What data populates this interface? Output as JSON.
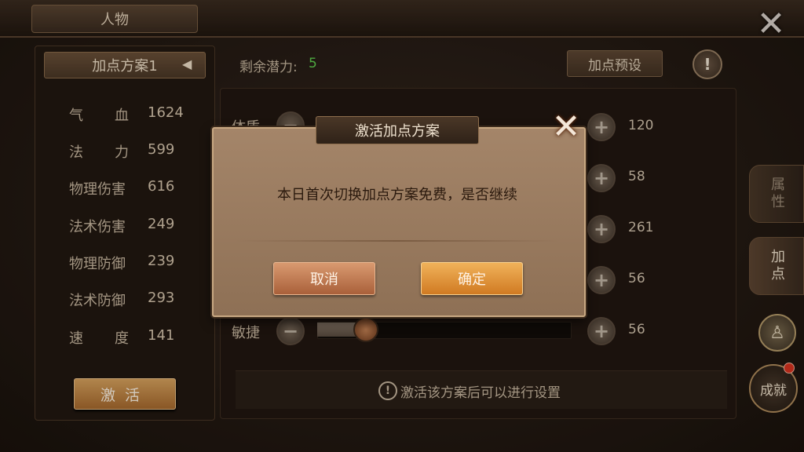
{
  "window": {
    "title": "人物"
  },
  "left_panel": {
    "scheme_label": "加点方案1",
    "stats": [
      {
        "label_chars": [
          "气",
          "血"
        ],
        "value": "1624"
      },
      {
        "label_chars": [
          "法",
          "力"
        ],
        "value": "599"
      },
      {
        "label": "物理伤害",
        "value": "616"
      },
      {
        "label": "法术伤害",
        "value": "249"
      },
      {
        "label": "物理防御",
        "value": "239"
      },
      {
        "label": "法术防御",
        "value": "293"
      },
      {
        "label_chars": [
          "速",
          "度"
        ],
        "value": "141"
      }
    ],
    "activate_label": "激活"
  },
  "main": {
    "remaining_label": "剩余潜力:",
    "remaining_value": "5",
    "preset_label": "加点预设",
    "attributes": [
      {
        "label": "体质",
        "value": "120"
      },
      {
        "label": "",
        "value": "58"
      },
      {
        "label": "",
        "value": "261"
      },
      {
        "label": "",
        "value": "56"
      },
      {
        "label": "敏捷",
        "value": "56"
      }
    ],
    "hint": "激活该方案后可以进行设置"
  },
  "side_tabs": {
    "attributes": "属性",
    "points": "加点",
    "achievement": "成就"
  },
  "dialog": {
    "title": "激活加点方案",
    "message": "本日首次切换加点方案免费，是否继续",
    "cancel": "取消",
    "confirm": "确定"
  },
  "icons": {
    "close": "close-icon",
    "info": "exclamation-icon",
    "plus": "plus-icon",
    "minus": "minus-icon",
    "pet": "pet-icon"
  },
  "colors": {
    "remaining_value": "#5fcf4f",
    "confirm_button": "#e08a2a",
    "notification_dot": "#d8321f"
  }
}
